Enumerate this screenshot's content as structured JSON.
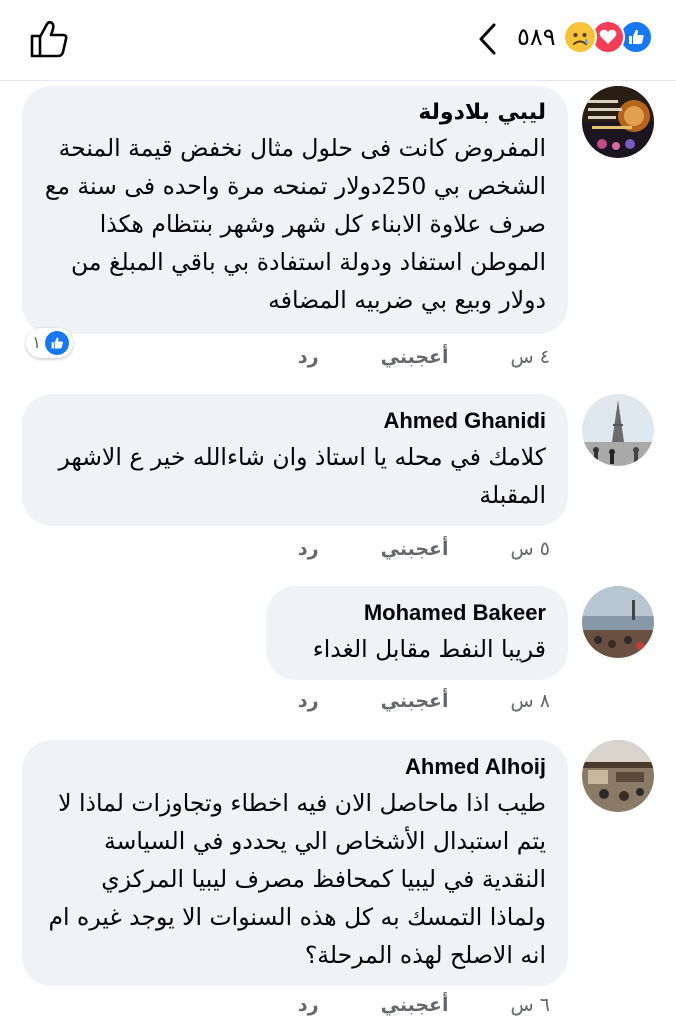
{
  "header": {
    "reaction_count": "٥٨٩",
    "reaction_icons": [
      "sad-icon",
      "love-icon",
      "like-icon"
    ]
  },
  "comments": [
    {
      "author": "ليبي بلادولة",
      "text": "المفروض كانت فى حلول مثال نخفض قيمة المنحة الشخص بي 250دولار تمنحه مرة واحده فى سنة مع صرف علاوة الابناء كل شهر وشهر بنتظام هكذا الموطن استفاد ودولة استفادة بي باقي المبلغ من دولار وبيع بي ضربيه المضافه",
      "time": "٤ س",
      "like_label": "أعجبني",
      "reply_label": "رد",
      "like_count": "١"
    },
    {
      "author": "Ahmed Ghanidi",
      "text": "كلامك في محله يا استاذ وان شاءالله خير ع الاشهر المقبلة",
      "time": "٥ س",
      "like_label": "أعجبني",
      "reply_label": "رد"
    },
    {
      "author": "Mohamed Bakeer",
      "text": "قريبا النفط مقابل الغداء",
      "time": "٨ س",
      "like_label": "أعجبني",
      "reply_label": "رد"
    },
    {
      "author": "Ahmed Alhoij",
      "text": "طيب اذا ماحاصل الان فيه اخطاء وتجاوزات لماذا لا يتم استبدال الأشخاص الي يحددو في السياسة النقدية في ليبيا كمحافظ مصرف ليبيا المركزي ولماذا التمسك به كل هذه السنوات الا يوجد غيره ام انه الاصلح لهذه المرحلة؟",
      "time": "٦ س",
      "like_label": "أعجبني",
      "reply_label": "رد"
    }
  ],
  "colors": {
    "accent": "#1877f2",
    "bubble": "#f0f2f5",
    "meta": "#65676b"
  }
}
